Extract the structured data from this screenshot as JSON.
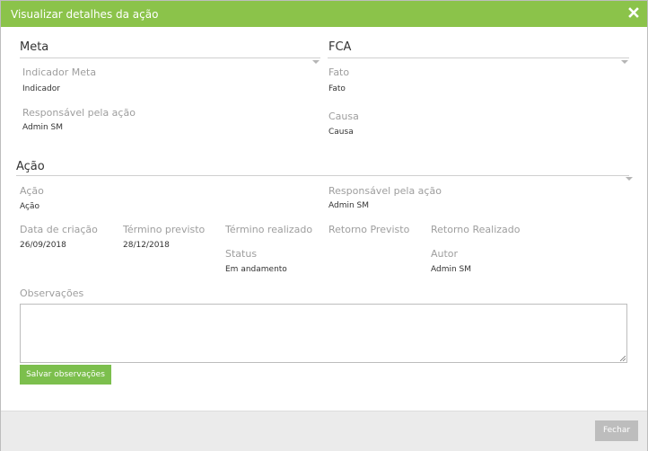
{
  "header": {
    "title": "Visualizar detalhes da ação"
  },
  "meta": {
    "title": "Meta",
    "indicador_label": "Indicador Meta",
    "indicador_value": "Indicador",
    "responsavel_label": "Responsável pela ação",
    "responsavel_value": "Admin SM"
  },
  "fca": {
    "title": "FCA",
    "fato_label": "Fato",
    "fato_value": "Fato",
    "causa_label": "Causa",
    "causa_value": "Causa"
  },
  "acao": {
    "title": "Ação",
    "acao_label": "Ação",
    "acao_value": "Ação",
    "responsavel_label": "Responsável pela ação",
    "responsavel_value": "Admin SM",
    "data_criacao_label": "Data de criação",
    "data_criacao_value": "26/09/2018",
    "termino_previsto_label": "Término previsto",
    "termino_previsto_value": "28/12/2018",
    "termino_realizado_label": "Término realizado",
    "retorno_previsto_label": "Retorno Previsto",
    "retorno_realizado_label": "Retorno Realizado",
    "status_label": "Status",
    "status_value": "Em andamento",
    "autor_label": "Autor",
    "autor_value": "Admin SM"
  },
  "observacoes": {
    "label": "Observações",
    "value": "",
    "save_label": "Salvar observações"
  },
  "footer": {
    "close_label": "Fechar"
  },
  "colors": {
    "accent": "#8bc34a",
    "button_green": "#7cbf4d",
    "close_button": "#bdbdbd"
  }
}
